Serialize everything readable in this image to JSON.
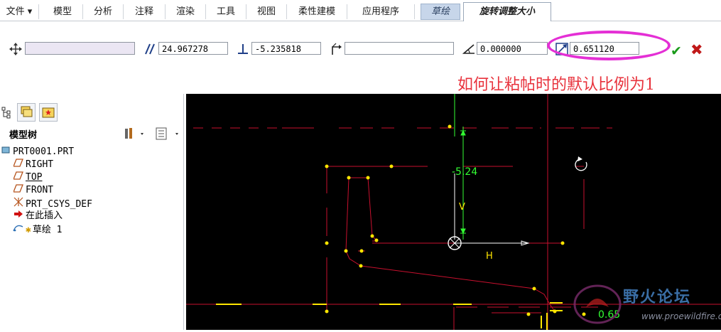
{
  "ribbon": {
    "tabs": [
      {
        "label": "文件 ▾"
      },
      {
        "label": "模型"
      },
      {
        "label": "分析"
      },
      {
        "label": "注释"
      },
      {
        "label": "渲染"
      },
      {
        "label": "工具"
      },
      {
        "label": "视图"
      },
      {
        "label": "柔性建模"
      },
      {
        "label": "应用程序"
      },
      {
        "label": "草绘"
      },
      {
        "label": "旋转调整大小"
      }
    ]
  },
  "resize_toolbar": {
    "move_value": "",
    "parallel_value": "24.967278",
    "perpendicular_value": "-5.235818",
    "reference_value": "",
    "angle_value": "0.000000",
    "scale_value": "0.651120",
    "icons": [
      "move-icon",
      "parallel-icon",
      "perpendicular-icon",
      "reference-icon",
      "angle-icon",
      "scale-icon"
    ]
  },
  "annotation": {
    "question": "如何让粘帖时的默认比例为1",
    "color": "#e8323c",
    "highlight_color": "#e42fd5"
  },
  "model_tree": {
    "label": "模型树",
    "items": [
      {
        "label": "PRT0001.PRT",
        "icon": "part-icon"
      },
      {
        "label": "RIGHT",
        "icon": "datum-plane-icon"
      },
      {
        "label": "TOP",
        "icon": "datum-plane-icon"
      },
      {
        "label": "FRONT",
        "icon": "datum-plane-icon"
      },
      {
        "label": "PRT_CSYS_DEF",
        "icon": "csys-icon"
      },
      {
        "label": "在此插入",
        "icon": "insert-arrow-icon"
      },
      {
        "label": "草绘 1",
        "icon": "sketch-icon"
      }
    ]
  },
  "graphics": {
    "dimension_v": "-5.24",
    "v_label": "V",
    "h_label": "H",
    "scale_label": "0.65",
    "watermark_title": "野火论坛",
    "watermark_url": "www.proewildfire.cn"
  },
  "colors": {
    "sketch_line": "#c8102e",
    "vertex": "#ffe600",
    "dimension": "#33ff33",
    "axis": "#33ff33"
  }
}
